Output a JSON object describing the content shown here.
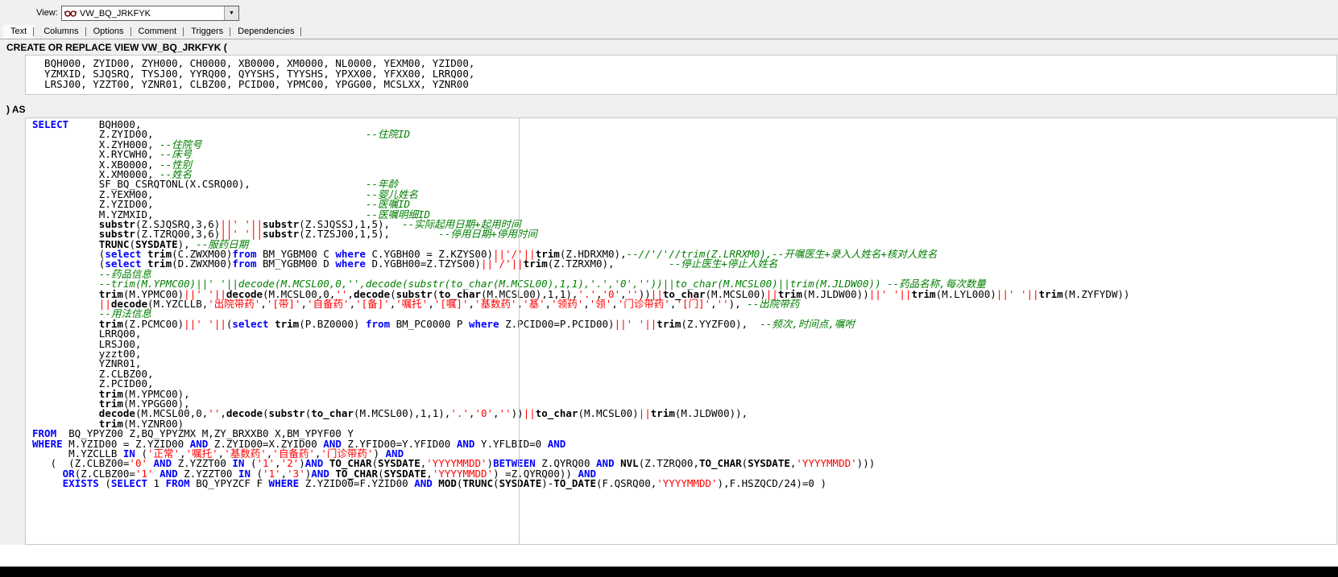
{
  "toolbar": {
    "view_label": "View:",
    "view_value": "VW_BQ_JRKFYK"
  },
  "tabs": [
    "Text",
    "Columns",
    "Options",
    "Comment",
    "Triggers",
    "Dependencies"
  ],
  "active_tab": "Text",
  "editor": {
    "create_line": "CREATE OR REPLACE VIEW VW_BQ_JRKFYK (",
    "as_line": ") AS",
    "column_lines": [
      "  BQH000, ZYID00, ZYH000, CH0000, XB0000, XM0000, NL0000, YEXM00, YZID00,",
      "  YZMXID, SJQSRQ, TYSJ00, YYRQ00, QYYSHS, TYYSHS, YPXX00, YFXX00, LRRQ00,",
      "  LRSJ00, YZZT00, YZNR01, CLBZ00, PCID00, YPMC00, YPGG00, MCSLXX, YZNR00"
    ],
    "code_lines": [
      [
        [
          "k",
          "SELECT"
        ],
        [
          "n",
          "     BQH000,"
        ]
      ],
      [
        [
          "n",
          "           Z.ZYID00,"
        ],
        [
          "n",
          "                                   "
        ],
        [
          "c",
          "--住院ID"
        ]
      ],
      [
        [
          "n",
          "           X.ZYH000, "
        ],
        [
          "c",
          "--住院号"
        ]
      ],
      [
        [
          "n",
          "           X.RYCWH0, "
        ],
        [
          "c",
          "--床号"
        ]
      ],
      [
        [
          "n",
          "           X.XB0000, "
        ],
        [
          "c",
          "--性别"
        ]
      ],
      [
        [
          "n",
          "           X.XM0000, "
        ],
        [
          "c",
          "--姓名"
        ]
      ],
      [
        [
          "n",
          "           SF_BQ_CSRQTONL(X.CSRQ00),"
        ],
        [
          "n",
          "                   "
        ],
        [
          "c",
          "--年龄"
        ]
      ],
      [
        [
          "n",
          "           Z.YEXM00,"
        ],
        [
          "n",
          "                                   "
        ],
        [
          "c",
          "--婴儿姓名"
        ]
      ],
      [
        [
          "n",
          "           Z.YZID00,"
        ],
        [
          "n",
          "                                   "
        ],
        [
          "c",
          "--医嘱ID"
        ]
      ],
      [
        [
          "n",
          "           M.YZMXID,"
        ],
        [
          "n",
          "                                   "
        ],
        [
          "c",
          "--医嘱明细ID"
        ]
      ],
      [
        [
          "n",
          "           "
        ],
        [
          "f",
          "substr"
        ],
        [
          "n",
          "(Z.SJQSRQ,3,6)"
        ],
        [
          "o",
          "||"
        ],
        [
          "s",
          "' '"
        ],
        [
          "o",
          "||"
        ],
        [
          "f",
          "substr"
        ],
        [
          "n",
          "(Z.SJQSSJ,1,5),  "
        ],
        [
          "c",
          "--实际起用日期+起用时间"
        ]
      ],
      [
        [
          "n",
          "           "
        ],
        [
          "f",
          "substr"
        ],
        [
          "n",
          "(Z.TZRQ00,3,6)"
        ],
        [
          "o",
          "||"
        ],
        [
          "s",
          "' '"
        ],
        [
          "o",
          "||"
        ],
        [
          "f",
          "substr"
        ],
        [
          "n",
          "(Z.TZSJ00,1,5),        "
        ],
        [
          "c",
          "--停用日期+停用时间"
        ]
      ],
      [
        [
          "n",
          "           "
        ],
        [
          "f",
          "TRUNC"
        ],
        [
          "n",
          "("
        ],
        [
          "f",
          "SYSDATE"
        ],
        [
          "n",
          "), "
        ],
        [
          "c",
          "--服药日期"
        ]
      ],
      [
        [
          "n",
          "           ("
        ],
        [
          "k",
          "select"
        ],
        [
          "n",
          " "
        ],
        [
          "f",
          "trim"
        ],
        [
          "n",
          "(C.ZWXM00)"
        ],
        [
          "k",
          "from"
        ],
        [
          "n",
          " BM_YGBM00 C "
        ],
        [
          "k",
          "where"
        ],
        [
          "n",
          " C.YGBH00 = Z.KZYS00)"
        ],
        [
          "o",
          "||"
        ],
        [
          "s",
          "'/'"
        ],
        [
          "o",
          "||"
        ],
        [
          "f",
          "trim"
        ],
        [
          "n",
          "(Z.HDRXM0),"
        ],
        [
          "c",
          "--//'/'//trim(Z.LRRXM0),--开嘱医生+录入人姓名+核对人姓名"
        ]
      ],
      [
        [
          "n",
          "           ("
        ],
        [
          "k",
          "select"
        ],
        [
          "n",
          " "
        ],
        [
          "f",
          "trim"
        ],
        [
          "n",
          "(D.ZWXM00)"
        ],
        [
          "k",
          "from"
        ],
        [
          "n",
          " BM_YGBM00 D "
        ],
        [
          "k",
          "where"
        ],
        [
          "n",
          " D.YGBH00=Z.TZYS00)"
        ],
        [
          "o",
          "||"
        ],
        [
          "s",
          "'/'"
        ],
        [
          "o",
          "||"
        ],
        [
          "f",
          "trim"
        ],
        [
          "n",
          "(Z.TZRXM0),         "
        ],
        [
          "c",
          "--停止医生+停止人姓名"
        ]
      ],
      [
        [
          "n",
          "           "
        ],
        [
          "c",
          "--药品信息"
        ]
      ],
      [
        [
          "n",
          "           "
        ],
        [
          "c",
          "--trim(M.YPMC00)||' '||decode(M.MCSL00,0,'',decode(substr(to_char(M.MCSL00),1,1),'.','0',''))||to_char(M.MCSL00)||trim(M.JLDW00)) --药品名称,每次数量"
        ]
      ],
      [
        [
          "n",
          "           "
        ],
        [
          "f",
          "trim"
        ],
        [
          "n",
          "(M.YPMC00)"
        ],
        [
          "o",
          "||"
        ],
        [
          "s",
          "' '"
        ],
        [
          "o",
          "||"
        ],
        [
          "f",
          "decode"
        ],
        [
          "n",
          "(M.MCSL00,0,"
        ],
        [
          "s",
          "''"
        ],
        [
          "n",
          ","
        ],
        [
          "f",
          "decode"
        ],
        [
          "n",
          "("
        ],
        [
          "f",
          "substr"
        ],
        [
          "n",
          "("
        ],
        [
          "f",
          "to_char"
        ],
        [
          "n",
          "(M.MCSL00),1,1),"
        ],
        [
          "s",
          "'.'"
        ],
        [
          "n",
          ","
        ],
        [
          "s",
          "'0'"
        ],
        [
          "n",
          ","
        ],
        [
          "s",
          "''"
        ],
        [
          "n",
          "))"
        ],
        [
          "o",
          "||"
        ],
        [
          "f",
          "to_char"
        ],
        [
          "n",
          "(M.MCSL00)"
        ],
        [
          "o",
          "||"
        ],
        [
          "f",
          "trim"
        ],
        [
          "n",
          "(M.JLDW00))"
        ],
        [
          "o",
          "||"
        ],
        [
          "s",
          "' '"
        ],
        [
          "o",
          "||"
        ],
        [
          "f",
          "trim"
        ],
        [
          "n",
          "(M.LYL000)"
        ],
        [
          "o",
          "||"
        ],
        [
          "s",
          "' '"
        ],
        [
          "o",
          "||"
        ],
        [
          "f",
          "trim"
        ],
        [
          "n",
          "(M.ZYFYDW))"
        ]
      ],
      [
        [
          "n",
          "           "
        ],
        [
          "o",
          "||"
        ],
        [
          "f",
          "decode"
        ],
        [
          "n",
          "(M.YZCLLB,"
        ],
        [
          "s",
          "'出院带药'"
        ],
        [
          "n",
          ","
        ],
        [
          "s",
          "'[带]'"
        ],
        [
          "n",
          ","
        ],
        [
          "s",
          "'自备药'"
        ],
        [
          "n",
          ","
        ],
        [
          "s",
          "'[备]'"
        ],
        [
          "n",
          ","
        ],
        [
          "s",
          "'嘱托'"
        ],
        [
          "n",
          ","
        ],
        [
          "s",
          "'[嘱]'"
        ],
        [
          "n",
          ","
        ],
        [
          "s",
          "'基数药'"
        ],
        [
          "n",
          ","
        ],
        [
          "s",
          "'基'"
        ],
        [
          "n",
          ","
        ],
        [
          "s",
          "'领药'"
        ],
        [
          "n",
          ","
        ],
        [
          "s",
          "'领'"
        ],
        [
          "n",
          ","
        ],
        [
          "s",
          "'门诊带药'"
        ],
        [
          "n",
          ","
        ],
        [
          "s",
          "'[门]'"
        ],
        [
          "n",
          ","
        ],
        [
          "s",
          "''"
        ],
        [
          "n",
          "), "
        ],
        [
          "c",
          "--出院带药"
        ]
      ],
      [
        [
          "n",
          "           "
        ],
        [
          "c",
          "--用法信息"
        ]
      ],
      [
        [
          "n",
          "           "
        ],
        [
          "f",
          "trim"
        ],
        [
          "n",
          "(Z.PCMC00)"
        ],
        [
          "o",
          "||"
        ],
        [
          "s",
          "' '"
        ],
        [
          "o",
          "||"
        ],
        [
          "n",
          "("
        ],
        [
          "k",
          "select"
        ],
        [
          "n",
          " "
        ],
        [
          "f",
          "trim"
        ],
        [
          "n",
          "(P.BZ0000) "
        ],
        [
          "k",
          "from"
        ],
        [
          "n",
          " BM_PC0000 P "
        ],
        [
          "k",
          "where"
        ],
        [
          "n",
          " Z.PCID00=P.PCID00)"
        ],
        [
          "o",
          "||"
        ],
        [
          "s",
          "' '"
        ],
        [
          "o",
          "||"
        ],
        [
          "f",
          "trim"
        ],
        [
          "n",
          "(Z.YYZF00),  "
        ],
        [
          "c",
          "--频次,时间点,嘱咐"
        ]
      ],
      [
        [
          "n",
          "           LRRQ00,"
        ]
      ],
      [
        [
          "n",
          "           LRSJ00,"
        ]
      ],
      [
        [
          "n",
          "           yzzt00,"
        ]
      ],
      [
        [
          "n",
          "           YZNR01,"
        ]
      ],
      [
        [
          "n",
          "           Z.CLBZ00,"
        ]
      ],
      [
        [
          "n",
          "           Z.PCID00,"
        ]
      ],
      [
        [
          "n",
          "           "
        ],
        [
          "f",
          "trim"
        ],
        [
          "n",
          "(M.YPMC00),"
        ]
      ],
      [
        [
          "n",
          "           "
        ],
        [
          "f",
          "trim"
        ],
        [
          "n",
          "(M.YPGG00),"
        ]
      ],
      [
        [
          "n",
          "           "
        ],
        [
          "f",
          "decode"
        ],
        [
          "n",
          "(M.MCSL00,0,"
        ],
        [
          "s",
          "''"
        ],
        [
          "n",
          ","
        ],
        [
          "f",
          "decode"
        ],
        [
          "n",
          "("
        ],
        [
          "f",
          "substr"
        ],
        [
          "n",
          "("
        ],
        [
          "f",
          "to_char"
        ],
        [
          "n",
          "(M.MCSL00),1,1),"
        ],
        [
          "s",
          "'.'"
        ],
        [
          "n",
          ","
        ],
        [
          "s",
          "'0'"
        ],
        [
          "n",
          ","
        ],
        [
          "s",
          "''"
        ],
        [
          "n",
          "))"
        ],
        [
          "o",
          "||"
        ],
        [
          "f",
          "to_char"
        ],
        [
          "n",
          "(M.MCSL00)"
        ],
        [
          "o",
          "||"
        ],
        [
          "f",
          "trim"
        ],
        [
          "n",
          "(M.JLDW00)),"
        ]
      ],
      [
        [
          "n",
          "           "
        ],
        [
          "f",
          "trim"
        ],
        [
          "n",
          "(M.YZNR00)"
        ]
      ],
      [
        [
          "k",
          "FROM"
        ],
        [
          "n",
          "  BQ_YPYZ00 Z,BQ_YPYZMX M,ZY_BRXXB0 X,BM_YPYF00 Y"
        ]
      ],
      [
        [
          "k",
          "WHERE"
        ],
        [
          "n",
          " M.YZID00 = Z.YZID00 "
        ],
        [
          "k",
          "AND"
        ],
        [
          "n",
          " Z.ZYID00=X.ZYID00 "
        ],
        [
          "k",
          "AND"
        ],
        [
          "n",
          " Z.YFID00=Y.YFID00 "
        ],
        [
          "k",
          "AND"
        ],
        [
          "n",
          " Y.YFLBID=0 "
        ],
        [
          "k",
          "AND"
        ]
      ],
      [
        [
          "n",
          "      M.YZCLLB "
        ],
        [
          "k",
          "IN"
        ],
        [
          "n",
          " ("
        ],
        [
          "s",
          "'正常'"
        ],
        [
          "n",
          ","
        ],
        [
          "s",
          "'嘱托'"
        ],
        [
          "n",
          ","
        ],
        [
          "s",
          "'基数药'"
        ],
        [
          "n",
          ","
        ],
        [
          "s",
          "'自备药'"
        ],
        [
          "n",
          ","
        ],
        [
          "s",
          "'门诊带药'"
        ],
        [
          "n",
          ") "
        ],
        [
          "k",
          "AND"
        ]
      ],
      [
        [
          "n",
          "   (  (Z.CLBZ00="
        ],
        [
          "s",
          "'0'"
        ],
        [
          "n",
          " "
        ],
        [
          "k",
          "AND"
        ],
        [
          "n",
          " Z.YZZT00 "
        ],
        [
          "k",
          "IN"
        ],
        [
          "n",
          " ("
        ],
        [
          "s",
          "'1'"
        ],
        [
          "n",
          ","
        ],
        [
          "s",
          "'2'"
        ],
        [
          "n",
          ")"
        ],
        [
          "k",
          "AND"
        ],
        [
          "n",
          " "
        ],
        [
          "f",
          "TO_CHAR"
        ],
        [
          "n",
          "("
        ],
        [
          "f",
          "SYSDATE"
        ],
        [
          "n",
          ","
        ],
        [
          "s",
          "'YYYYMMDD'"
        ],
        [
          "n",
          ")"
        ],
        [
          "k",
          "BETWEEN"
        ],
        [
          "n",
          " Z.QYRQ00 "
        ],
        [
          "k",
          "AND"
        ],
        [
          "n",
          " "
        ],
        [
          "f",
          "NVL"
        ],
        [
          "n",
          "(Z.TZRQ00,"
        ],
        [
          "f",
          "TO_CHAR"
        ],
        [
          "n",
          "("
        ],
        [
          "f",
          "SYSDATE"
        ],
        [
          "n",
          ","
        ],
        [
          "s",
          "'YYYYMMDD'"
        ],
        [
          "n",
          ")))"
        ]
      ],
      [
        [
          "n",
          "     "
        ],
        [
          "k",
          "OR"
        ],
        [
          "n",
          "(Z.CLBZ00="
        ],
        [
          "s",
          "'1'"
        ],
        [
          "n",
          " "
        ],
        [
          "k",
          "AND"
        ],
        [
          "n",
          " Z.YZZT00 "
        ],
        [
          "k",
          "IN"
        ],
        [
          "n",
          " ("
        ],
        [
          "s",
          "'1'"
        ],
        [
          "n",
          ","
        ],
        [
          "s",
          "'3'"
        ],
        [
          "n",
          ")"
        ],
        [
          "k",
          "AND"
        ],
        [
          "n",
          " "
        ],
        [
          "f",
          "TO_CHAR"
        ],
        [
          "n",
          "("
        ],
        [
          "f",
          "SYSDATE"
        ],
        [
          "n",
          ","
        ],
        [
          "s",
          "'YYYYMMDD'"
        ],
        [
          "n",
          ") =Z.QYRQ00)) "
        ],
        [
          "k",
          "AND"
        ]
      ],
      [
        [
          "n",
          "     "
        ],
        [
          "k",
          "EXISTS"
        ],
        [
          "n",
          " ("
        ],
        [
          "k",
          "SELECT"
        ],
        [
          "n",
          " 1 "
        ],
        [
          "k",
          "FROM"
        ],
        [
          "n",
          " BQ_YPYZCF F "
        ],
        [
          "k",
          "WHERE"
        ],
        [
          "n",
          " Z.YZID00=F.YZID00 "
        ],
        [
          "k",
          "AND"
        ],
        [
          "n",
          " "
        ],
        [
          "f",
          "MOD"
        ],
        [
          "n",
          "("
        ],
        [
          "f",
          "TRUNC"
        ],
        [
          "n",
          "("
        ],
        [
          "f",
          "SYSDATE"
        ],
        [
          "n",
          ")-"
        ],
        [
          "f",
          "TO_DATE"
        ],
        [
          "n",
          "(F.QSRQ00,"
        ],
        [
          "s",
          "'YYYYMMDD'"
        ],
        [
          "n",
          "),F.HSZQCD/24)=0 )"
        ]
      ]
    ]
  },
  "colors": {
    "keyword": "#0000ff",
    "builtin": "#000000",
    "comment": "#007f00",
    "string": "#ff0000",
    "operator": "#ff0000",
    "identifier": "#000000",
    "header_text": "#000000",
    "editor_background": "#ffffff",
    "window_background": "#f0f0f0",
    "bottom_bar": "#000000"
  }
}
